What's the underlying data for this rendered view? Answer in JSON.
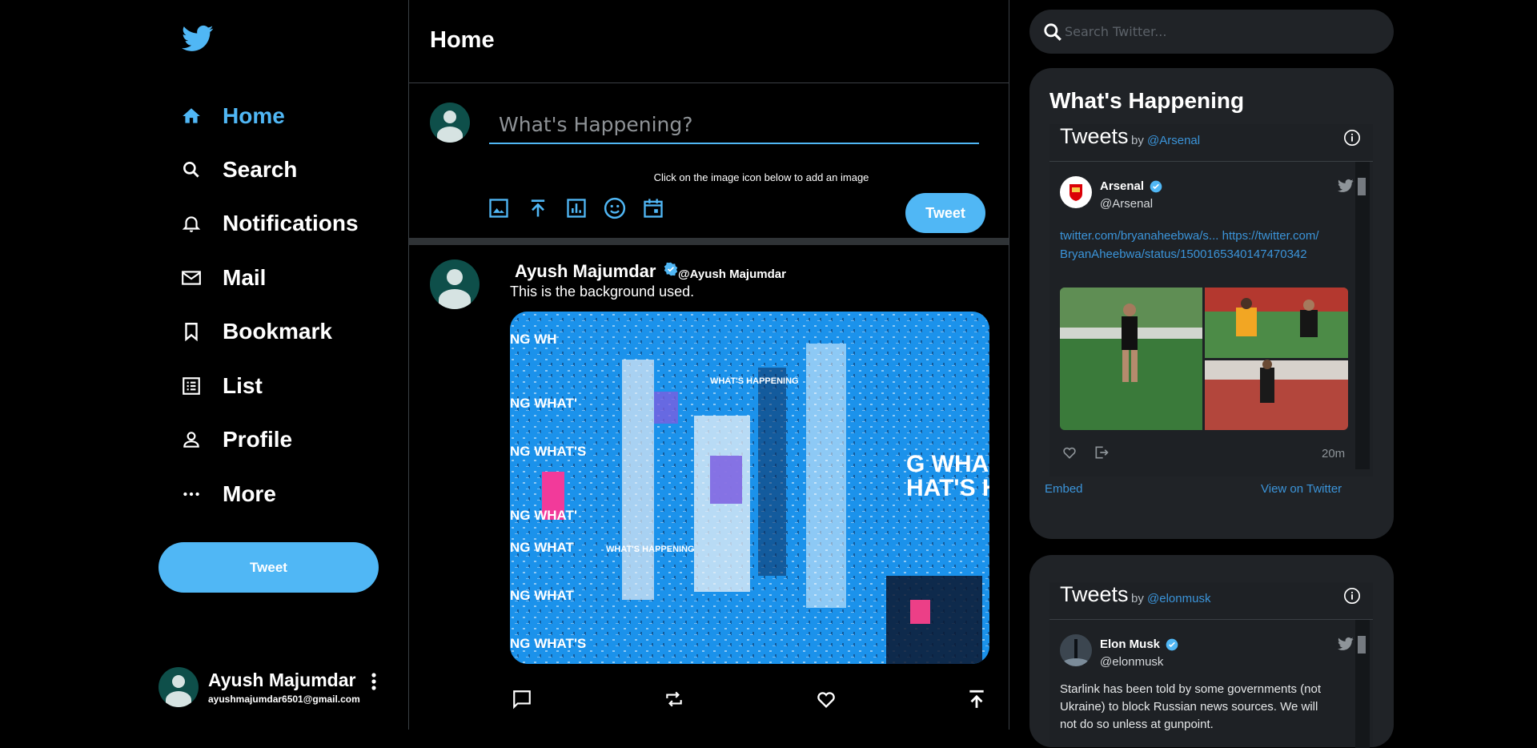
{
  "sidebar": {
    "nav": [
      {
        "label": "Home",
        "icon": "home-icon",
        "active": true
      },
      {
        "label": "Search",
        "icon": "search-icon"
      },
      {
        "label": "Notifications",
        "icon": "bell-icon"
      },
      {
        "label": "Mail",
        "icon": "mail-icon"
      },
      {
        "label": "Bookmark",
        "icon": "bookmark-icon"
      },
      {
        "label": "List",
        "icon": "list-icon"
      },
      {
        "label": "Profile",
        "icon": "person-icon"
      },
      {
        "label": "More",
        "icon": "more-icon"
      }
    ],
    "tweet_button": "Tweet",
    "profile": {
      "name": "Ayush Majumdar",
      "email": "ayushmajumdar6501@gmail.com"
    }
  },
  "feed": {
    "title": "Home",
    "composer": {
      "placeholder": "What's Happening?",
      "hint": "Click on the image icon below to add an image",
      "tweet_button": "Tweet",
      "icons": [
        "image-icon",
        "upload-icon",
        "poll-icon",
        "emoji-icon",
        "schedule-icon"
      ]
    },
    "post": {
      "name": "Ayush Majumdar",
      "handle": "@Ayush Majumdar",
      "text": "This is the background used.",
      "media_text": "WHAT'S HAPPENING",
      "actions": [
        "reply-icon",
        "retweet-icon",
        "like-icon",
        "share-icon"
      ]
    }
  },
  "right": {
    "search_placeholder": "Search Twitter...",
    "widget_title": "What's Happening",
    "embeds": [
      {
        "title": "Tweets",
        "by": "by",
        "by_handle": "@Arsenal",
        "tweet": {
          "name": "Arsenal",
          "handle": "@Arsenal",
          "link1": "twitter.com/bryanaheebwa/s...",
          "link2": "https://twitter.com/BryanAheebwa/status/1500165340147470342",
          "time": "20m"
        },
        "embed_label": "Embed",
        "view_label": "View on Twitter"
      },
      {
        "title": "Tweets",
        "by": "by",
        "by_handle": "@elonmusk",
        "tweet": {
          "name": "Elon Musk",
          "handle": "@elonmusk",
          "text": "Starlink has been told by some governments (not Ukraine) to block Russian news sources. We will not do so unless at gunpoint."
        }
      }
    ]
  },
  "colors": {
    "accent": "#50b7f5",
    "panel": "#202327",
    "link": "#3b94d9",
    "avatar_bg": "#0e4f4a"
  }
}
